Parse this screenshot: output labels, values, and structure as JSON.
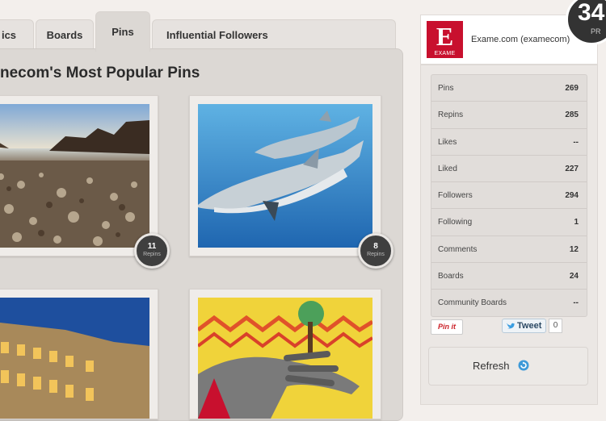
{
  "tabs": [
    {
      "label": "ics"
    },
    {
      "label": "Boards"
    },
    {
      "label": "Pins"
    },
    {
      "label": "Influential Followers"
    }
  ],
  "main": {
    "title": "necom's Most Popular Pins",
    "pins": [
      {
        "image": "glass-beach-shore",
        "repins": "11",
        "repins_label": "Repins"
      },
      {
        "image": "dolphins-underwater",
        "repins": "8",
        "repins_label": "Repins"
      },
      {
        "image": "colosseum-night"
      },
      {
        "image": "graffiti-hand-mural"
      }
    ]
  },
  "profile": {
    "logo_letter": "E",
    "logo_word": "EXAME",
    "name": "Exame.com (examecom)",
    "score": "34",
    "score_label": "PR"
  },
  "stats": [
    {
      "label": "Pins",
      "value": "269"
    },
    {
      "label": "Repins",
      "value": "285"
    },
    {
      "label": "Likes",
      "value": "--"
    },
    {
      "label": "Liked",
      "value": "227"
    },
    {
      "label": "Followers",
      "value": "294"
    },
    {
      "label": "Following",
      "value": "1"
    },
    {
      "label": "Comments",
      "value": "12"
    },
    {
      "label": "Boards",
      "value": "24"
    },
    {
      "label": "Community Boards",
      "value": "--"
    }
  ],
  "social": {
    "pinit_label": "Pin it",
    "tweet_label": "Tweet",
    "tweet_count": "0"
  },
  "refresh_label": "Refresh",
  "colors": {
    "brand_red": "#c8102e",
    "twitter_blue": "#2b4863"
  }
}
